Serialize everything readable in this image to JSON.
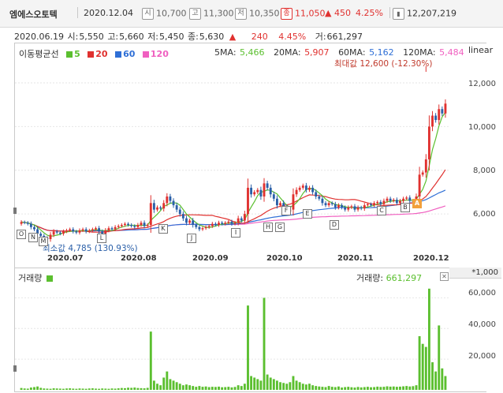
{
  "header": {
    "name": "엠에스오토텍",
    "date": "2020.12.04",
    "open_tag": "시",
    "open": "10,700",
    "high_tag": "고",
    "high": "11,300",
    "low_tag": "저",
    "low": "10,350",
    "close_tag": "종",
    "close": "11,050",
    "change": "▲ 450",
    "change_pct": "4.25%",
    "volume": "12,207,219"
  },
  "info": {
    "date": "2020.06.19",
    "open_label": "시:",
    "open": "5,550",
    "high_label": "고:",
    "high": "5,660",
    "low_label": "저:",
    "low": "5,450",
    "close_label": "종:",
    "close": "5,630",
    "arrow": "▲",
    "change": "240",
    "change_pct": "4.45%",
    "vol_label": "거:",
    "volume": "661,297"
  },
  "legend": {
    "title": "이동평균선",
    "items": [
      {
        "label": "5",
        "color": "#5bbf2f"
      },
      {
        "label": "20",
        "color": "#e0312f"
      },
      {
        "label": "60",
        "color": "#2f6fd6"
      },
      {
        "label": "120",
        "color": "#f060c0"
      }
    ]
  },
  "ma_values": {
    "ma5_label": "5MA:",
    "ma5": "5,466",
    "ma20_label": "20MA:",
    "ma20": "5,907",
    "ma60_label": "60MA:",
    "ma60": "5,162",
    "ma120_label": "120MA:",
    "ma120": "5,484"
  },
  "scale_mode": "linear",
  "annotations": {
    "max": "최대값 12,600 (-12.30%)",
    "min": "최소값 4,785 (130.93%)"
  },
  "colors": {
    "up": "#e0312f",
    "down": "#2a5fa8",
    "ma5": "#5bbf2f",
    "ma20": "#e0312f",
    "ma60": "#2f6fd6",
    "ma120": "#f060c0",
    "volume": "#5bbf2f"
  },
  "markers": [
    "O",
    "N",
    "M",
    "L",
    "K",
    "J",
    "I",
    "H",
    "G",
    "F",
    "E",
    "D",
    "C",
    "B",
    "A"
  ],
  "volume_panel": {
    "title": "거래량",
    "label": "거래량:",
    "value": "661,297",
    "unit": "*1,000",
    "close_glyph": "✕"
  },
  "chart_data": {
    "type": "candlestick",
    "price_axis": {
      "ticks": [
        "12,000",
        "10,000",
        "8,000",
        "6,000"
      ],
      "tick_values": [
        12000,
        10000,
        8000,
        6000
      ],
      "ylim": [
        4200,
        13300
      ]
    },
    "x_labels": [
      "2020.07",
      "2020.08",
      "2020.09",
      "2020.10",
      "2020.11",
      "2020.12"
    ],
    "volume_axis": {
      "ticks": [
        "60,000",
        "40,000",
        "20,000"
      ],
      "tick_values": [
        60000,
        40000,
        20000
      ],
      "ylim": [
        0,
        70000
      ]
    },
    "close": [
      5630,
      5600,
      5550,
      5400,
      5300,
      5100,
      5000,
      4900,
      4850,
      5050,
      5200,
      5150,
      5100,
      5200,
      5250,
      5300,
      5200,
      5150,
      5250,
      5300,
      5200,
      5250,
      5300,
      5350,
      5200,
      5100,
      5250,
      5350,
      5300,
      5400,
      5450,
      5500,
      5550,
      5500,
      5450,
      5400,
      5500,
      5600,
      5450,
      5500,
      6500,
      6200,
      6300,
      6250,
      6500,
      6800,
      6600,
      6400,
      6200,
      6000,
      5800,
      5600,
      5700,
      5500,
      5400,
      5300,
      5350,
      5400,
      5450,
      5550,
      5500,
      5600,
      5550,
      5600,
      5650,
      5550,
      5600,
      5800,
      5700,
      6000,
      7200,
      6900,
      7000,
      7100,
      6800,
      7400,
      7200,
      6900,
      6700,
      6400,
      6500,
      6300,
      6100,
      6200,
      6900,
      7100,
      7200,
      7300,
      7100,
      7200,
      7000,
      6800,
      6700,
      6500,
      6400,
      6500,
      6450,
      6300,
      6400,
      6300,
      6200,
      6300,
      6350,
      6200,
      6300,
      6250,
      6400,
      6450,
      6400,
      6500,
      6550,
      6450,
      6600,
      6700,
      6600,
      6650,
      6500,
      6600,
      6700,
      6750,
      6600,
      6550,
      6800,
      7800,
      7900,
      8500,
      10000,
      10500,
      10300,
      10800,
      10600,
      11050
    ],
    "volume": [
      1200,
      900,
      800,
      1500,
      1800,
      2200,
      1300,
      900,
      800,
      700,
      1000,
      900,
      800,
      700,
      900,
      1000,
      800,
      700,
      900,
      800,
      700,
      900,
      1000,
      800,
      700,
      900,
      800,
      700,
      900,
      800,
      1000,
      1200,
      1100,
      1400,
      1300,
      1500,
      1200,
      1100,
      1000,
      1300,
      38000,
      6000,
      4000,
      3000,
      8000,
      12000,
      7000,
      6000,
      5000,
      4000,
      3000,
      3500,
      3000,
      2500,
      2000,
      2500,
      2000,
      2200,
      1800,
      2000,
      1900,
      2100,
      1700,
      1800,
      2000,
      1600,
      1900,
      3000,
      2500,
      4000,
      55000,
      9000,
      8000,
      7000,
      6000,
      60000,
      10000,
      8000,
      7000,
      6000,
      5000,
      4500,
      4000,
      5000,
      9000,
      6000,
      5000,
      4000,
      3500,
      4000,
      3000,
      2500,
      2200,
      2000,
      1800,
      2500,
      2000,
      1800,
      2200,
      1500,
      1800,
      2000,
      1700,
      1500,
      1900,
      1600,
      1800,
      2000,
      1700,
      1800,
      2100,
      1900,
      2000,
      2300,
      2100,
      2200,
      2000,
      2100,
      2300,
      2500,
      2200,
      2400,
      3000,
      35000,
      30000,
      28000,
      66000,
      18000,
      12000,
      42000,
      14000,
      9000
    ]
  }
}
